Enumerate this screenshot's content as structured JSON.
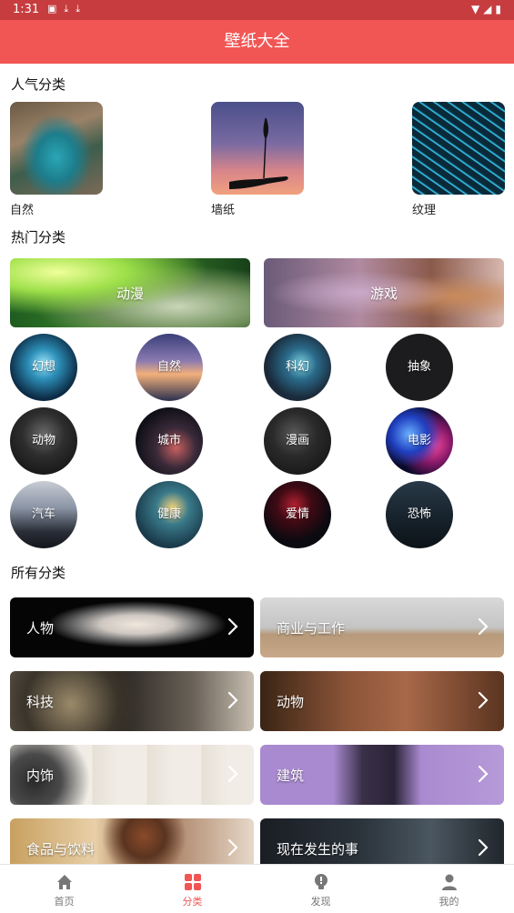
{
  "status": {
    "time": "1:31"
  },
  "app": {
    "title": "壁纸大全"
  },
  "sections": {
    "popular": "人气分类",
    "hot": "热门分类",
    "all": "所有分类"
  },
  "popular": [
    {
      "label": "自然"
    },
    {
      "label": "墙纸"
    },
    {
      "label": "纹理"
    }
  ],
  "hot_banners": [
    {
      "label": "动漫"
    },
    {
      "label": "游戏"
    }
  ],
  "hot_circles": [
    {
      "label": "幻想"
    },
    {
      "label": "自然"
    },
    {
      "label": "科幻"
    },
    {
      "label": "抽象"
    },
    {
      "label": "动物"
    },
    {
      "label": "城市"
    },
    {
      "label": "漫画"
    },
    {
      "label": "电影"
    },
    {
      "label": "汽车"
    },
    {
      "label": "健康"
    },
    {
      "label": "爱情"
    },
    {
      "label": "恐怖"
    }
  ],
  "all_categories": [
    {
      "label": "人物"
    },
    {
      "label": "商业与工作"
    },
    {
      "label": "科技"
    },
    {
      "label": "动物"
    },
    {
      "label": "内饰"
    },
    {
      "label": "建筑"
    },
    {
      "label": "食品与饮料"
    },
    {
      "label": "现在发生的事"
    }
  ],
  "nav": [
    {
      "label": "首页",
      "icon": "home-icon"
    },
    {
      "label": "分类",
      "icon": "grid-icon",
      "active": true
    },
    {
      "label": "发现",
      "icon": "bulb-icon"
    },
    {
      "label": "我的",
      "icon": "person-icon"
    }
  ],
  "colors": {
    "statusbar": "#c73d3f",
    "appbar": "#f15655",
    "accent": "#f15655"
  }
}
